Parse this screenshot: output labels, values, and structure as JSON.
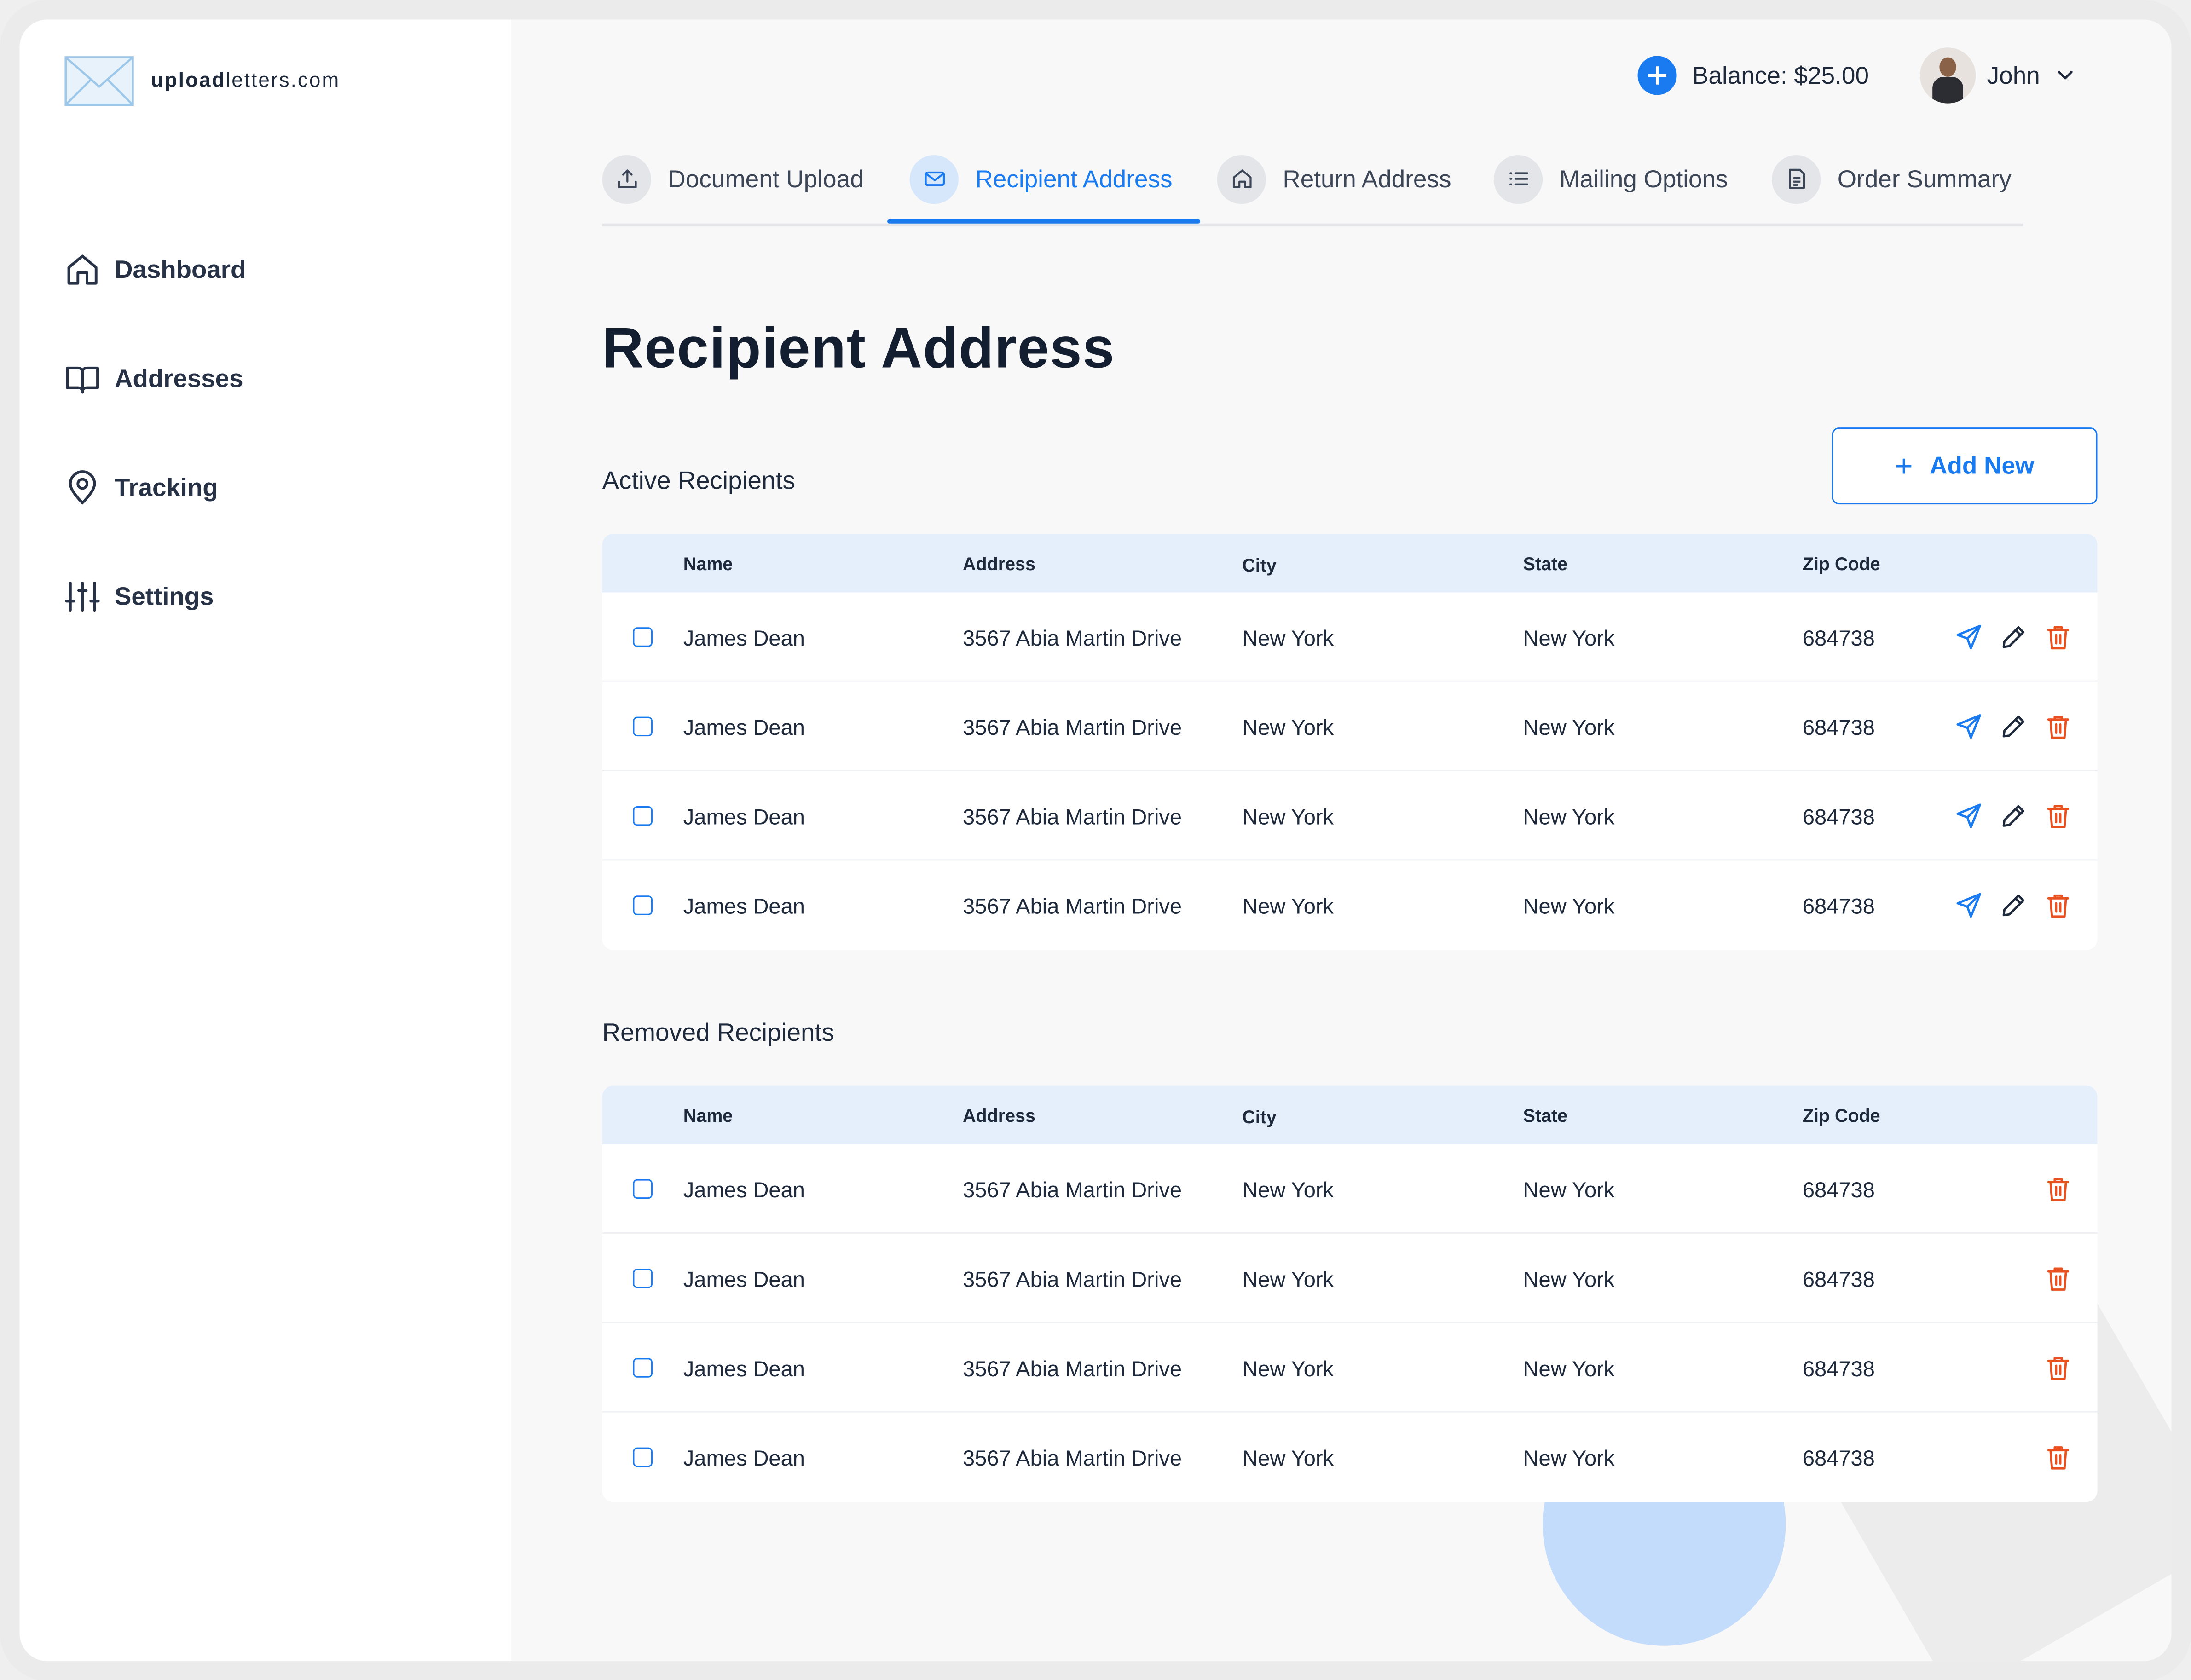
{
  "brand": {
    "name_bold": "upload",
    "name_rest": "letters.com"
  },
  "sidebar": {
    "items": [
      {
        "label": "Dashboard",
        "icon": "home-icon"
      },
      {
        "label": "Addresses",
        "icon": "book-icon"
      },
      {
        "label": "Tracking",
        "icon": "location-pin-icon"
      },
      {
        "label": "Settings",
        "icon": "sliders-icon"
      }
    ]
  },
  "header": {
    "balance": "Balance: $25.00",
    "user_name": "John"
  },
  "steps": [
    {
      "label": "Document Upload",
      "icon": "upload-icon",
      "active": false
    },
    {
      "label": "Recipient Address",
      "icon": "mail-icon",
      "active": true
    },
    {
      "label": "Return Address",
      "icon": "home-icon",
      "active": false
    },
    {
      "label": "Mailing Options",
      "icon": "list-icon",
      "active": false
    },
    {
      "label": "Order Summary",
      "icon": "document-icon",
      "active": false
    }
  ],
  "page": {
    "title": "Recipient Address",
    "add_button": "Add New"
  },
  "columns": [
    "Name",
    "Address",
    "City",
    "State",
    "Zip Code"
  ],
  "active": {
    "title": "Active Recipients",
    "rows": [
      {
        "name": "James Dean",
        "address": "3567 Abia Martin Drive",
        "city": "New York",
        "state": "New York",
        "zip": "684738"
      },
      {
        "name": "James Dean",
        "address": "3567 Abia Martin Drive",
        "city": "New York",
        "state": "New York",
        "zip": "684738"
      },
      {
        "name": "James Dean",
        "address": "3567 Abia Martin Drive",
        "city": "New York",
        "state": "New York",
        "zip": "684738"
      },
      {
        "name": "James Dean",
        "address": "3567 Abia Martin Drive",
        "city": "New York",
        "state": "New York",
        "zip": "684738"
      }
    ]
  },
  "removed": {
    "title": "Removed Recipients",
    "rows": [
      {
        "name": "James Dean",
        "address": "3567 Abia Martin Drive",
        "city": "New York",
        "state": "New York",
        "zip": "684738"
      },
      {
        "name": "James Dean",
        "address": "3567 Abia Martin Drive",
        "city": "New York",
        "state": "New York",
        "zip": "684738"
      },
      {
        "name": "James Dean",
        "address": "3567 Abia Martin Drive",
        "city": "New York",
        "state": "New York",
        "zip": "684738"
      },
      {
        "name": "James Dean",
        "address": "3567 Abia Martin Drive",
        "city": "New York",
        "state": "New York",
        "zip": "684738"
      }
    ]
  },
  "colors": {
    "accent": "#1a7bf1",
    "danger": "#e8501f",
    "header_bg": "#e5effc"
  }
}
